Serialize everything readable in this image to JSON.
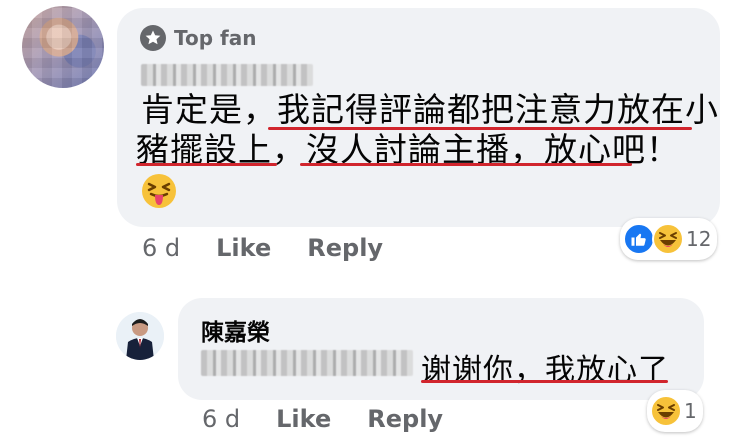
{
  "comment": {
    "badge": "Top fan",
    "line1": "肯定是，我記得評論都把注意力放在小",
    "line2": "豬擺設上，沒人討論主播，放心吧！",
    "time": "6 d",
    "like_label": "Like",
    "reply_label": "Reply",
    "reaction_count": "12",
    "reaction_icons": [
      "like-icon",
      "laugh-icon"
    ],
    "emoji_icon": "squinting-tongue-emoji"
  },
  "reply": {
    "author": "陳嘉榮",
    "text": "谢谢你，我放心了",
    "time": "6 d",
    "like_label": "Like",
    "reply_label": "Reply",
    "reaction_count": "1",
    "reaction_icons": [
      "laugh-icon"
    ]
  },
  "colors": {
    "bubble": "#f0f2f5",
    "meta_text": "#65676b",
    "underline": "#d1252d",
    "like_blue": "#1877f2",
    "emoji_yellow": "#f7c23a"
  }
}
